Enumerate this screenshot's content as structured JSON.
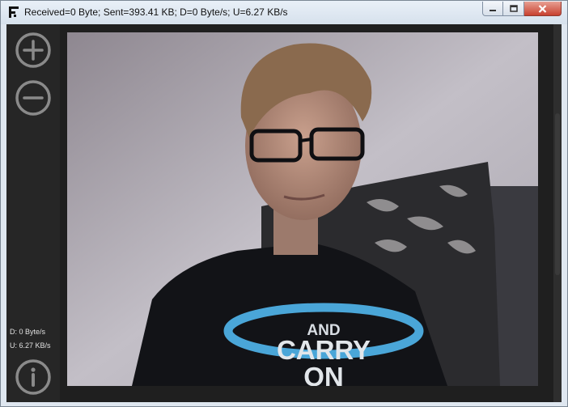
{
  "window": {
    "title": "Received=0 Byte; Sent=393.41 KB; D=0 Byte/s; U=6.27 KB/s",
    "controls": [
      "minimize-icon",
      "maximize-icon",
      "close-icon"
    ]
  },
  "sidebar": {
    "zoom_in_icon": "plus-circle-icon",
    "zoom_out_icon": "minus-circle-icon",
    "info_icon": "info-circle-icon",
    "download_rate": "D: 0 Byte/s",
    "upload_rate": "U: 6.27 KB/s"
  },
  "video": {
    "shirt_text_line1": "AND",
    "shirt_text_line2": "CARRY",
    "shirt_text_line3": "ON"
  },
  "colors": {
    "sidebar_bg": "#262626",
    "client_bg": "#1f1f1f",
    "icon_stroke": "#8a8a8a",
    "shirt_ring": "#4aa6d8"
  }
}
